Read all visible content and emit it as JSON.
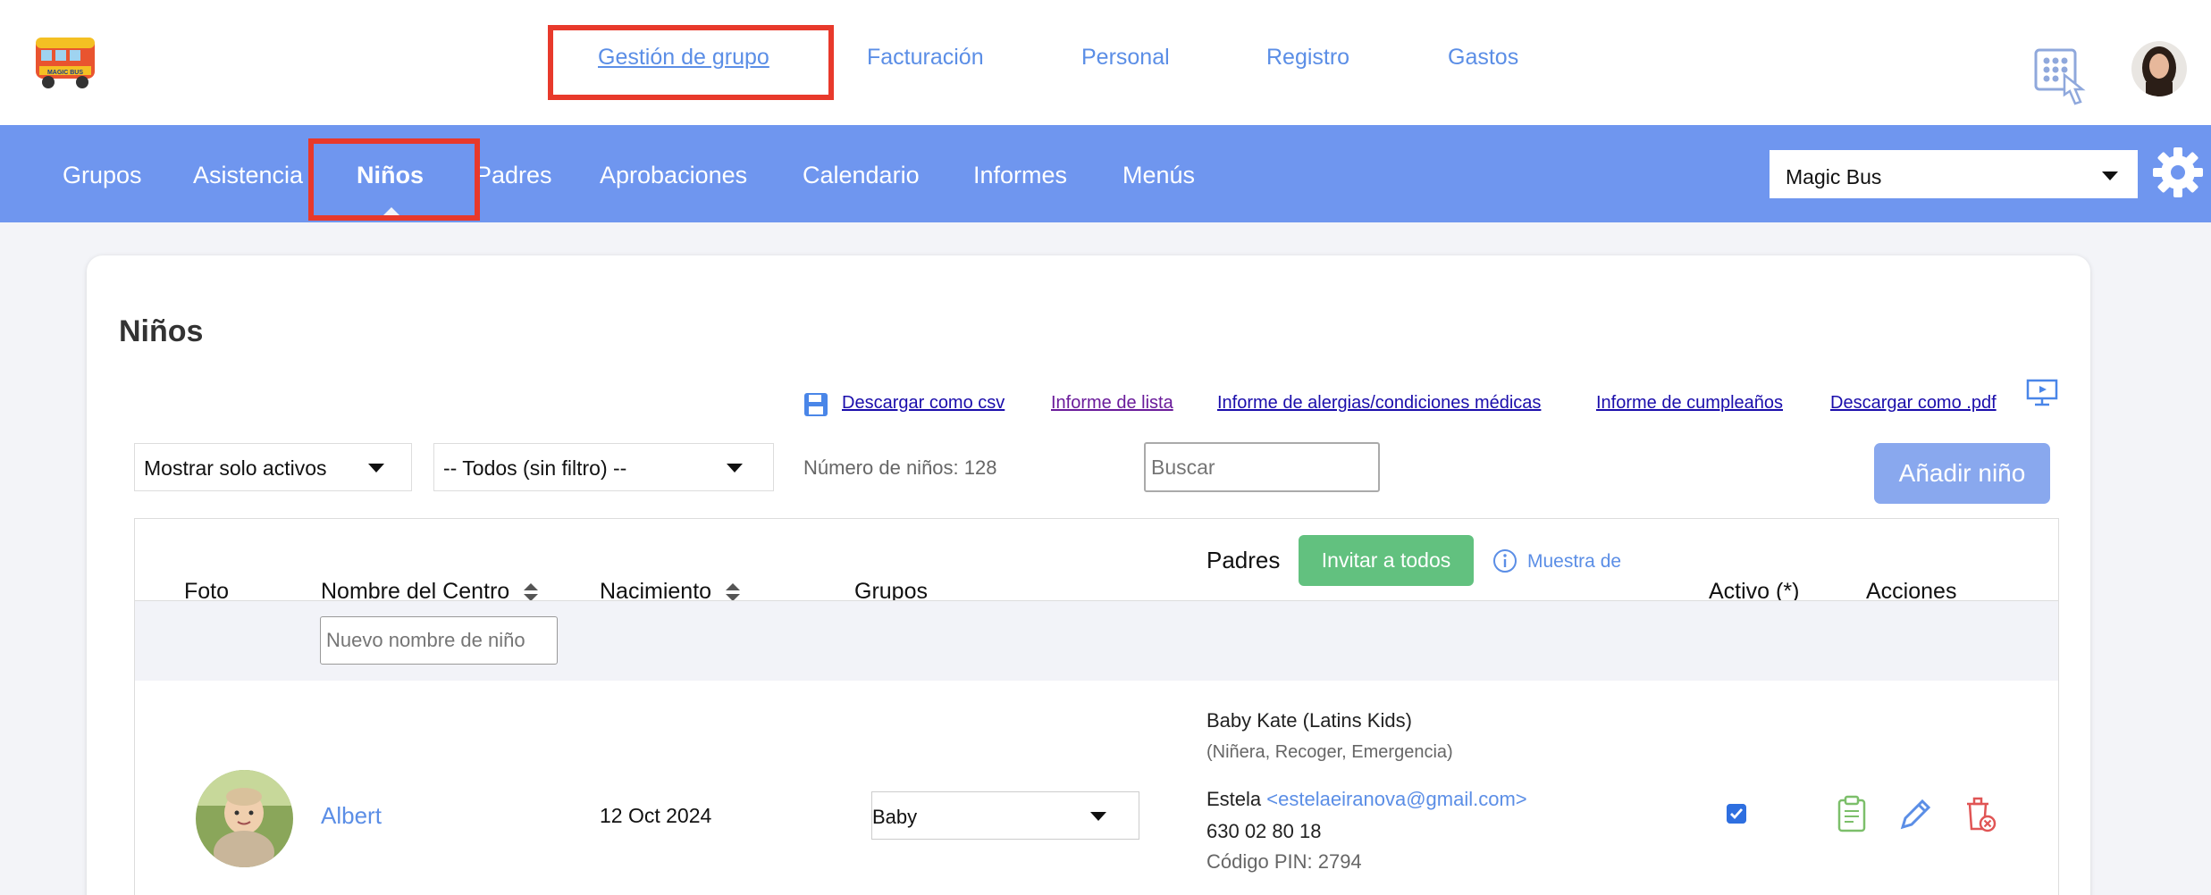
{
  "header": {
    "nav": [
      "Gestión de grupo",
      "Facturación",
      "Personal",
      "Registro",
      "Gastos"
    ],
    "logo_text": "MAGIC BUS"
  },
  "subnav": {
    "items": [
      "Grupos",
      "Asistencia",
      "Niños",
      "Padres",
      "Aprobaciones",
      "Calendario",
      "Informes",
      "Menús"
    ],
    "active": "Niños",
    "center_select": "Magic Bus"
  },
  "page": {
    "title": "Niños",
    "links": [
      "Descargar como csv",
      "Informe de lista",
      "Informe de alergias/condiciones médicas",
      "Informe de cumpleaños",
      "Descargar como .pdf"
    ],
    "filter_status": "Mostrar solo activos",
    "filter_group": "-- Todos (sin filtro) --",
    "count_text": "Número de niños: 128",
    "search_placeholder": "Buscar",
    "add_button": "Añadir niño"
  },
  "table": {
    "headers": {
      "foto": "Foto",
      "nombre": "Nombre del Centro",
      "nacimiento": "Nacimiento",
      "grupos": "Grupos",
      "padres": "Padres",
      "activo": "Activo (*)",
      "acciones": "Acciones"
    },
    "invite_button": "Invitar a todos",
    "sample_link": "Muestra de",
    "new_name_placeholder": "Nuevo nombre de niño",
    "rows": [
      {
        "name": "Albert",
        "birth": "12 Oct 2024",
        "group": "Baby",
        "contact1_name": "Baby Kate (Latins Kids)",
        "contact1_roles": "(Niñera, Recoger, Emergencia)",
        "contact2_name": "Estela",
        "contact2_email": "<estelaeiranova@gmail.com>",
        "contact2_phone": "630 02 80 18",
        "contact2_pin": "Código PIN: 2794",
        "active": true
      }
    ]
  },
  "colors": {
    "accent_blue": "#6f96ef",
    "link_blue": "#5b8ee6",
    "highlight_red": "#e8392b",
    "invite_green": "#62c17f",
    "add_button": "#89a8ee"
  }
}
